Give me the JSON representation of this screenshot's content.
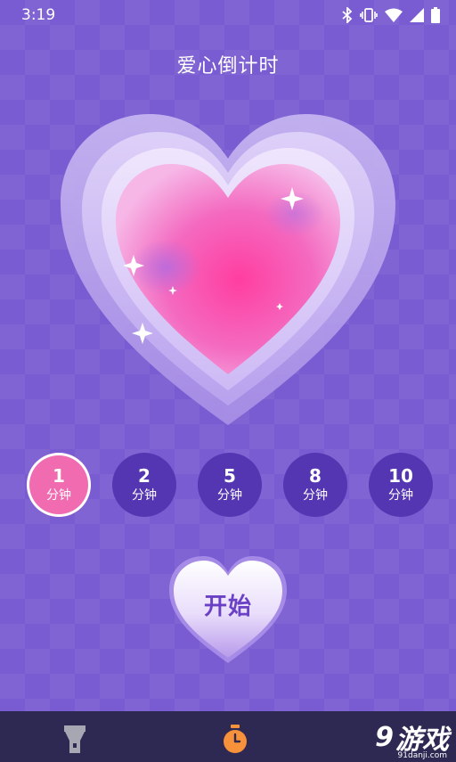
{
  "status_bar": {
    "time": "3:19",
    "icons": [
      "bluetooth-icon",
      "vibrate-icon",
      "wifi-icon",
      "signal-icon",
      "battery-icon"
    ]
  },
  "header": {
    "title": "爱心倒计时"
  },
  "timer_options": [
    {
      "value": "1",
      "unit": "分钟",
      "selected": true
    },
    {
      "value": "2",
      "unit": "分钟",
      "selected": false
    },
    {
      "value": "5",
      "unit": "分钟",
      "selected": false
    },
    {
      "value": "8",
      "unit": "分钟",
      "selected": false
    },
    {
      "value": "10",
      "unit": "分钟",
      "selected": false
    }
  ],
  "start_button": {
    "label": "开始"
  },
  "bottom_nav": {
    "items": [
      {
        "icon": "flashlight-icon"
      },
      {
        "icon": "stopwatch-icon",
        "active": true
      }
    ]
  },
  "watermark": {
    "logo": "9",
    "text": "游戏",
    "sub": "91danji.com"
  },
  "colors": {
    "background": "#7a5cd2",
    "timer_default": "#5436b3",
    "timer_selected": "#f06bb0",
    "bottom_bar": "#2e2952",
    "stopwatch_accent": "#f7923a"
  }
}
